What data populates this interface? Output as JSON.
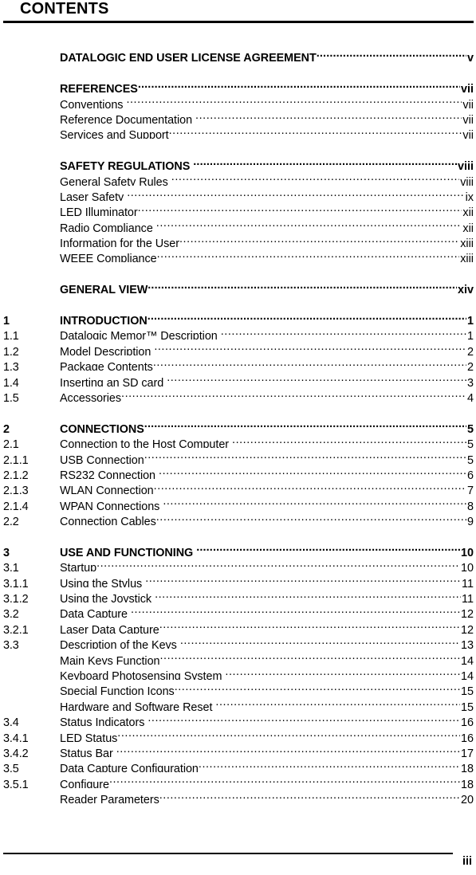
{
  "document": {
    "heading": "CONTENTS",
    "footer_page_number": "iii"
  },
  "toc": {
    "entries": [
      {
        "number": "",
        "label": "DATALOGIC END USER LICENSE AGREEMENT",
        "page": "v",
        "level": 1,
        "gap": false
      },
      {
        "spacer": true
      },
      {
        "number": "",
        "label": "REFERENCES",
        "page": "vii",
        "level": 1,
        "gap": false
      },
      {
        "number": "",
        "label": "Conventions",
        "page": "vii",
        "level": 2,
        "gap": true
      },
      {
        "number": "",
        "label": "Reference Documentation",
        "page": "vii",
        "level": 2,
        "gap": true
      },
      {
        "number": "",
        "label": "Services and Support",
        "page": "vii",
        "level": 2,
        "gap": false
      },
      {
        "spacer": true
      },
      {
        "number": "",
        "label": "SAFETY REGULATIONS",
        "page": "viii",
        "level": 1,
        "gap": true
      },
      {
        "number": "",
        "label": "General Safety Rules",
        "page": "viii",
        "level": 2,
        "gap": true
      },
      {
        "number": "",
        "label": "Laser Safety",
        "page": "ix",
        "level": 2,
        "gap": true
      },
      {
        "number": "",
        "label": "LED Illuminator",
        "page": "xii",
        "level": 2,
        "gap": false
      },
      {
        "number": "",
        "label": "Radio Compliance",
        "page": "xii",
        "level": 2,
        "gap": true
      },
      {
        "number": "",
        "label": "Information for the User",
        "page": "xiii",
        "level": 2,
        "gap": false
      },
      {
        "number": "",
        "label": "WEEE Compliance",
        "page": "xiii",
        "level": 2,
        "gap": false
      },
      {
        "spacer": true
      },
      {
        "number": "",
        "label": "GENERAL VIEW",
        "page": "xiv",
        "level": 1,
        "gap": false
      },
      {
        "spacer": true
      },
      {
        "number": "1",
        "label": "INTRODUCTION",
        "page": "1",
        "level": 1,
        "gap": false
      },
      {
        "number": "1.1",
        "label": "Datalogic Memor™ Description",
        "page": "1",
        "level": 2,
        "gap": true
      },
      {
        "number": "1.2",
        "label": "Model Description",
        "page": "2",
        "level": 2,
        "gap": true
      },
      {
        "number": "1.3",
        "label": "Package Contents",
        "page": "2",
        "level": 2,
        "gap": false
      },
      {
        "number": "1.4",
        "label": "Inserting an SD card",
        "page": "3",
        "level": 2,
        "gap": true
      },
      {
        "number": "1.5",
        "label": "Accessories",
        "page": "4",
        "level": 2,
        "gap": false
      },
      {
        "spacer": true
      },
      {
        "number": "2",
        "label": "CONNECTIONS",
        "page": "5",
        "level": 1,
        "gap": false
      },
      {
        "number": "2.1",
        "label": "Connection to the Host Computer",
        "page": "5",
        "level": 2,
        "gap": true
      },
      {
        "number": "2.1.1",
        "label": "USB Connection",
        "page": "5",
        "level": 2,
        "gap": false
      },
      {
        "number": "2.1.2",
        "label": "RS232 Connection",
        "page": "6",
        "level": 2,
        "gap": true
      },
      {
        "number": "2.1.3",
        "label": "WLAN Connection",
        "page": "7",
        "level": 2,
        "gap": false
      },
      {
        "number": "2.1.4",
        "label": "WPAN Connections",
        "page": "8",
        "level": 2,
        "gap": true
      },
      {
        "number": "2.2",
        "label": "Connection Cables",
        "page": "9",
        "level": 2,
        "gap": false
      },
      {
        "spacer": true
      },
      {
        "number": "3",
        "label": "USE AND FUNCTIONING",
        "page": "10",
        "level": 1,
        "gap": true
      },
      {
        "number": "3.1",
        "label": "Startup",
        "page": "10",
        "level": 2,
        "gap": false
      },
      {
        "number": "3.1.1",
        "label": "Using the Stylus",
        "page": "11",
        "level": 2,
        "gap": true
      },
      {
        "number": "3.1.2",
        "label": "Using the Joystick",
        "page": "11",
        "level": 2,
        "gap": true
      },
      {
        "number": "3.2",
        "label": "Data Capture",
        "page": "12",
        "level": 2,
        "gap": true
      },
      {
        "number": "3.2.1",
        "label": "Laser Data Capture",
        "page": "12",
        "level": 2,
        "gap": false
      },
      {
        "number": "3.3",
        "label": "Description of the Keys",
        "page": "13",
        "level": 2,
        "gap": true
      },
      {
        "number": "",
        "label": "Main Keys Function",
        "page": "14",
        "level": 2,
        "gap": false
      },
      {
        "number": "",
        "label": "Keyboard Photosensing System",
        "page": "14",
        "level": 2,
        "gap": true
      },
      {
        "number": "",
        "label": "Special Function Icons",
        "page": "15",
        "level": 2,
        "gap": false
      },
      {
        "number": "",
        "label": "Hardware and Software Reset",
        "page": "15",
        "level": 2,
        "gap": true
      },
      {
        "number": "3.4",
        "label": "Status Indicators",
        "page": "16",
        "level": 2,
        "gap": true
      },
      {
        "number": "3.4.1",
        "label": "LED Status",
        "page": "16",
        "level": 2,
        "gap": false
      },
      {
        "number": "3.4.2",
        "label": "Status Bar",
        "page": "17",
        "level": 2,
        "gap": true
      },
      {
        "number": "3.5",
        "label": "Data Capture Configuration",
        "page": "18",
        "level": 2,
        "gap": false
      },
      {
        "number": "3.5.1",
        "label": "Configure",
        "page": "18",
        "level": 2,
        "gap": false
      },
      {
        "number": "",
        "label": "Reader Parameters",
        "page": "20",
        "level": 2,
        "gap": false
      }
    ]
  }
}
